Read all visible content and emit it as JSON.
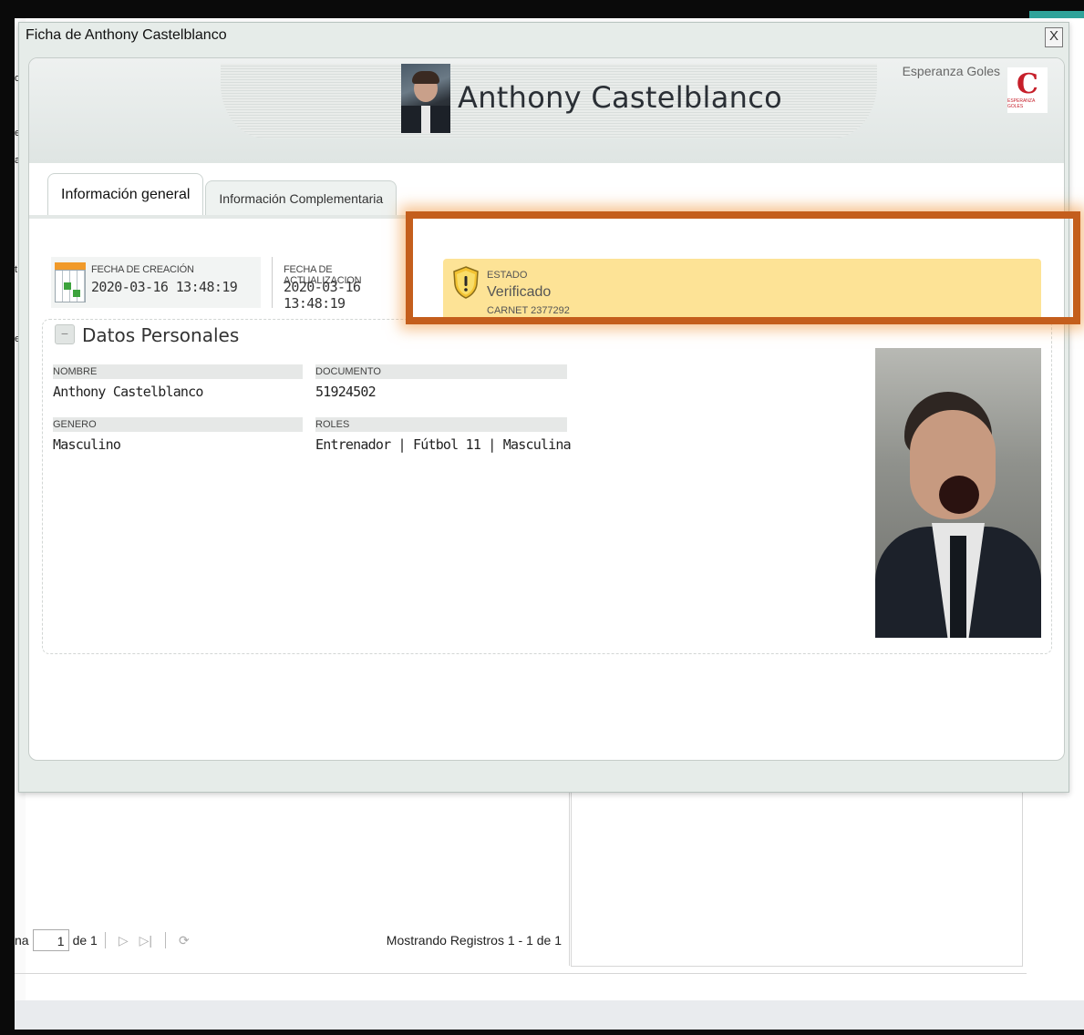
{
  "modal": {
    "title": "Ficha de Anthony Castelblanco",
    "close_label": "X"
  },
  "header": {
    "name": "Anthony Castelblanco",
    "org_name": "Esperanza Goles",
    "logo_letter": "C",
    "logo_text": "ESPERANZA GOLES"
  },
  "tabs": [
    {
      "label": "Información general"
    },
    {
      "label": "Información Complementaria"
    }
  ],
  "info": {
    "created_label": "FECHA DE CREACIÓN",
    "created_value": "2020-03-16 13:48:19",
    "updated_label": "FECHA DE ACTUALIZACION",
    "updated_value": "2020-03-16 13:48:19"
  },
  "estado": {
    "label": "ESTADO",
    "value": "Verificado",
    "carnet": "CARNET 2377292",
    "icon": "shield-warning-icon",
    "bg_color": "#fde396",
    "highlight_color": "#c45e1c"
  },
  "personal": {
    "section_title": "Datos Personales",
    "collapse_label": "−",
    "fields": [
      {
        "label": "NOMBRE",
        "value": "Anthony Castelblanco"
      },
      {
        "label": "DOCUMENTO",
        "value": "51924502"
      },
      {
        "label": "GENERO",
        "value": "Masculino"
      },
      {
        "label": "ROLES",
        "value": "Entrenador | Fútbol 11 | Masculina"
      }
    ]
  },
  "background": {
    "pager_prefix": "na",
    "pager_page": "1",
    "pager_of": "de 1",
    "pager_status": "Mostrando Registros 1 - 1 de 1"
  }
}
